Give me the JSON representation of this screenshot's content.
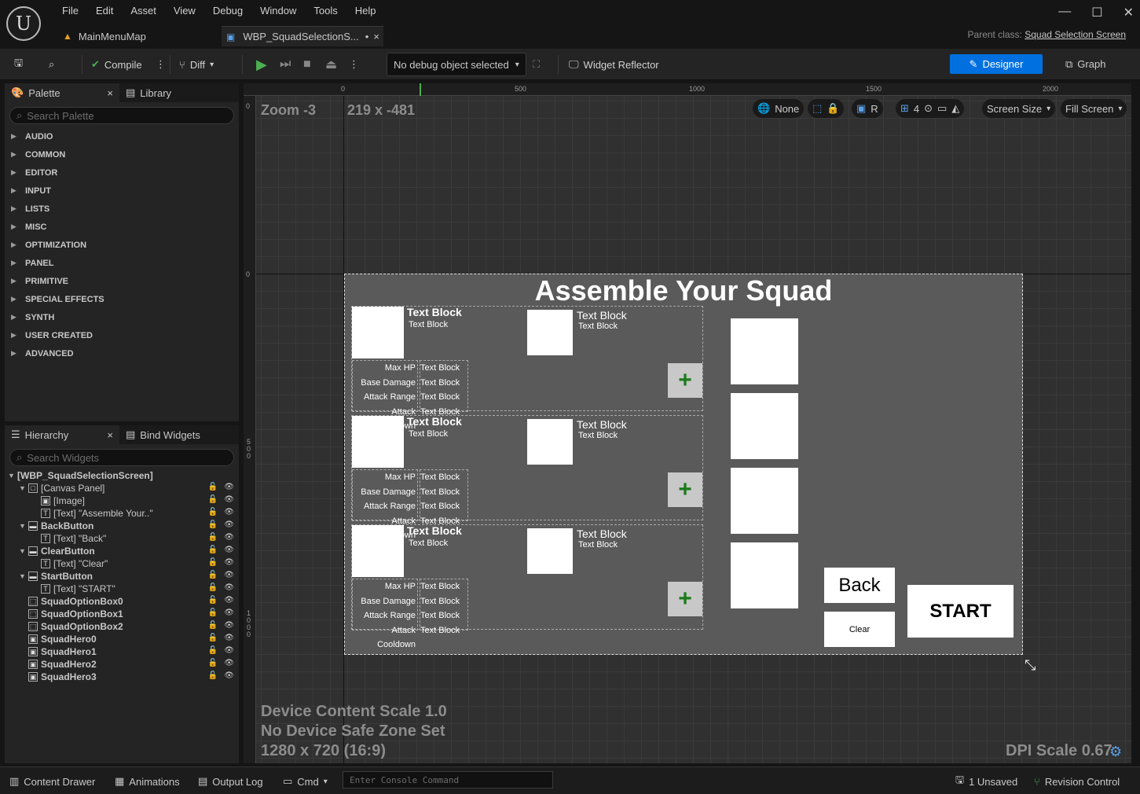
{
  "menu": [
    "File",
    "Edit",
    "Asset",
    "View",
    "Debug",
    "Window",
    "Tools",
    "Help"
  ],
  "tabs": [
    {
      "label": "MainMenuMap"
    },
    {
      "label": "WBP_SquadSelectionS...",
      "dirty": "•",
      "close": "×"
    }
  ],
  "parent_class": {
    "label": "Parent class:",
    "value": "Squad Selection Screen"
  },
  "toolbar": {
    "compile": "Compile",
    "diff": "Diff",
    "debug_object": "No debug object selected",
    "widget_reflector": "Widget Reflector",
    "designer": "Designer",
    "graph": "Graph"
  },
  "palette": {
    "tab_palette": "Palette",
    "tab_library": "Library",
    "search_placeholder": "Search Palette",
    "categories": [
      "AUDIO",
      "COMMON",
      "EDITOR",
      "INPUT",
      "LISTS",
      "MISC",
      "OPTIMIZATION",
      "PANEL",
      "PRIMITIVE",
      "SPECIAL EFFECTS",
      "SYNTH",
      "USER CREATED",
      "ADVANCED"
    ]
  },
  "hierarchy": {
    "tab_hierarchy": "Hierarchy",
    "tab_bind": "Bind Widgets",
    "search_placeholder": "Search Widgets",
    "root": "[WBP_SquadSelectionScreen]",
    "items": [
      {
        "label": "[Canvas Panel]",
        "bold": false
      },
      {
        "label": "[Image]",
        "bold": false
      },
      {
        "label": "[Text] \"Assemble Your..\"",
        "bold": false
      },
      {
        "label": "BackButton",
        "bold": true
      },
      {
        "label": "[Text] \"Back\"",
        "bold": false
      },
      {
        "label": "ClearButton",
        "bold": true
      },
      {
        "label": "[Text] \"Clear\"",
        "bold": false
      },
      {
        "label": "StartButton",
        "bold": true
      },
      {
        "label": "[Text] \"START\"",
        "bold": false
      },
      {
        "label": "SquadOptionBox0",
        "bold": true
      },
      {
        "label": "SquadOptionBox1",
        "bold": true
      },
      {
        "label": "SquadOptionBox2",
        "bold": true
      },
      {
        "label": "SquadHero0",
        "bold": true
      },
      {
        "label": "SquadHero1",
        "bold": true
      },
      {
        "label": "SquadHero2",
        "bold": true
      },
      {
        "label": "SquadHero3",
        "bold": true
      }
    ]
  },
  "viewport": {
    "zoom": "Zoom -3",
    "coords": "219 x -481",
    "ruler_top": [
      "0",
      "500",
      "1000",
      "1500",
      "2000"
    ],
    "ruler_left_top": "0",
    "ruler_left_mid": "0",
    "ruler_left_500": "500",
    "ruler_left_1000": "1000",
    "none_label": "None",
    "r_label": "R",
    "grid_num": "4",
    "screen_size": "Screen Size",
    "fill_screen": "Fill Screen",
    "device_scale": "Device Content Scale 1.0",
    "safe_zone": "No Device Safe Zone Set",
    "resolution": "1280 x 720 (16:9)",
    "dpi": "DPI Scale 0.67"
  },
  "widget": {
    "title": "Assemble Your Squad",
    "text_block": "Text Block",
    "stat_labels": [
      "Max HP",
      "Base Damage",
      "Attack Range",
      "Attack Cooldown"
    ],
    "plus": "+",
    "back": "Back",
    "clear": "Clear",
    "start": "START"
  },
  "statusbar": {
    "content_drawer": "Content Drawer",
    "animations": "Animations",
    "output_log": "Output Log",
    "cmd": "Cmd",
    "console_placeholder": "Enter Console Command",
    "unsaved": "1 Unsaved",
    "revision": "Revision Control"
  }
}
